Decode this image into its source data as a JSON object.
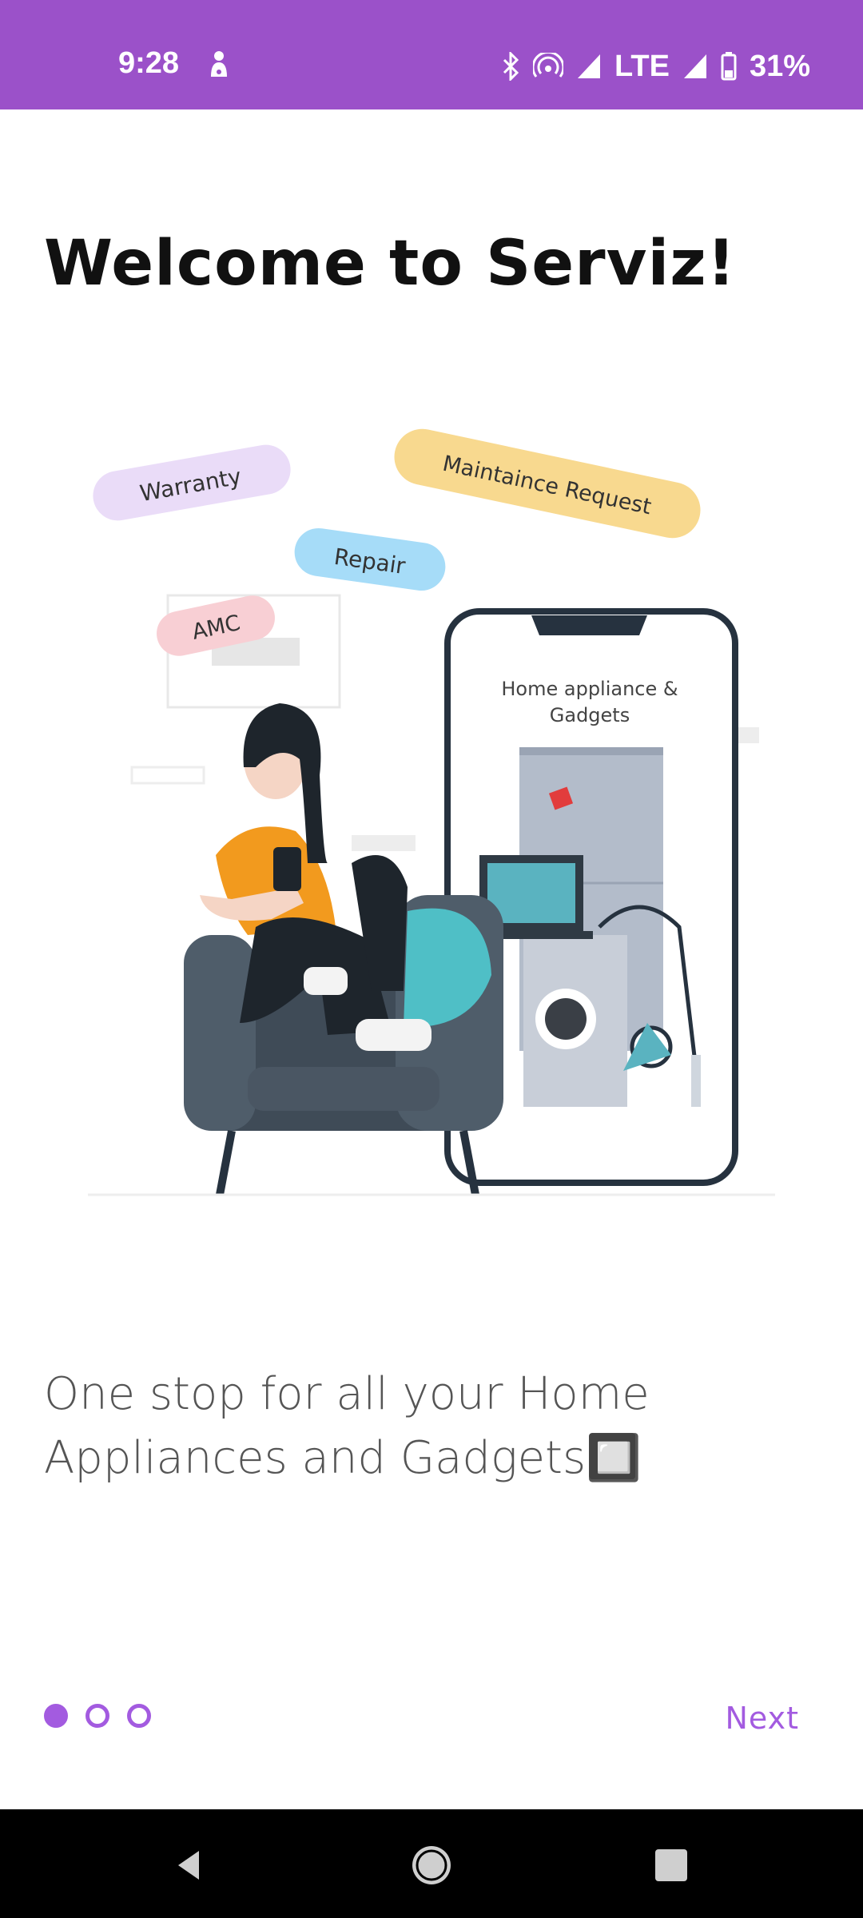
{
  "status_bar": {
    "time": "9:28",
    "network": "LTE",
    "battery": "31%",
    "icons": [
      "notification-icon",
      "bluetooth-icon",
      "hotspot-icon",
      "signal-icon",
      "signal-icon",
      "battery-icon"
    ]
  },
  "onboarding": {
    "title": "Welcome to Serviz!",
    "illustration": {
      "bubbles": [
        "Warranty",
        "Maintaince Request",
        "Repair",
        "AMC"
      ],
      "phone_text_line1": "Home appliance &",
      "phone_text_line2": "Gadgets"
    },
    "tagline": "One stop for all your Home Appliances and Gadgets🔲",
    "page_indicator": {
      "total": 3,
      "current": 1
    },
    "next_label": "Next"
  },
  "colors": {
    "brand": "#9b51c9",
    "accent": "#a35be0"
  },
  "nav_bar": {
    "buttons": [
      "back-icon",
      "home-icon",
      "recents-icon"
    ]
  }
}
